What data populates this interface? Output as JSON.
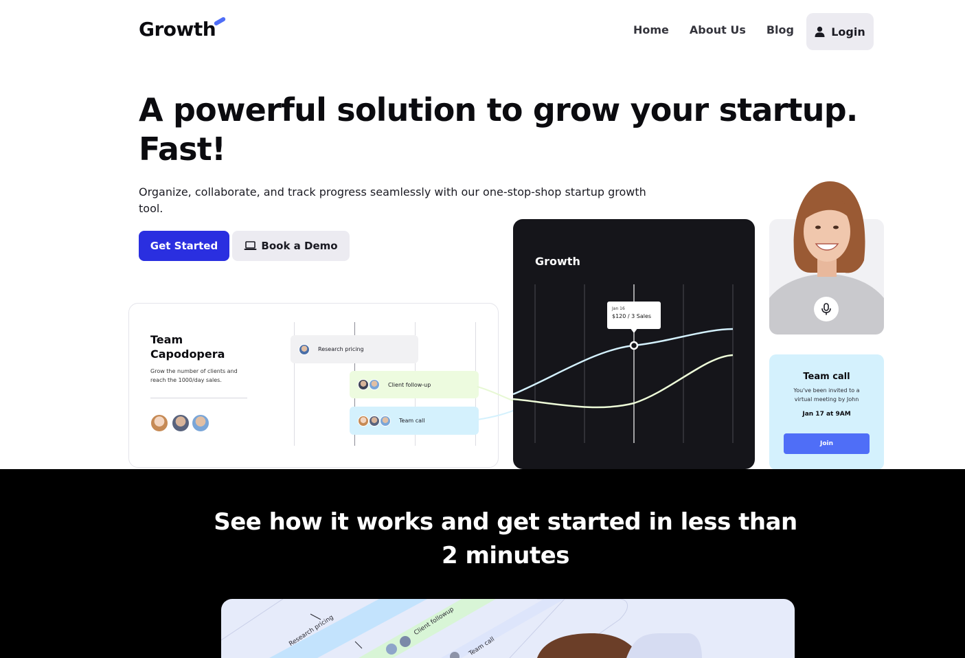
{
  "nav": {
    "brand": "Growth",
    "links": [
      "Home",
      "About Us",
      "Blog"
    ],
    "login_label": "Login"
  },
  "hero": {
    "title_line1": "A powerful solution to grow your startup.",
    "title_line2": "Fast!",
    "subtitle": "Organize, collaborate, and track progress seamlessly with our one-stop-shop startup growth tool.",
    "primary_cta": "Get Started",
    "secondary_cta": "Book a Demo"
  },
  "team_card": {
    "name": "Team Capodopera",
    "description": "Grow the number of clients and reach the 1000/day sales.",
    "tasks": [
      "Research pricing",
      "Client follow-up",
      "Team call"
    ]
  },
  "growth_card": {
    "title": "Growth",
    "tooltip_date": "Jan 16",
    "tooltip_value": "$120 / 3 Sales"
  },
  "call_card": {
    "title": "Team call",
    "text": "You've been invited to a virtual meeting by John",
    "time": "Jan 17 at 9AM",
    "join_label": "Join"
  },
  "works": {
    "title": "See how it works and get started in less than 2 minutes",
    "preview_tasks": [
      "Research pricing",
      "Client followup",
      "Team call"
    ]
  },
  "colors": {
    "primary": "#2a2fe0",
    "accent": "#4f6ef7",
    "dark": "#15151a",
    "call_bg": "#d4f1fd"
  }
}
